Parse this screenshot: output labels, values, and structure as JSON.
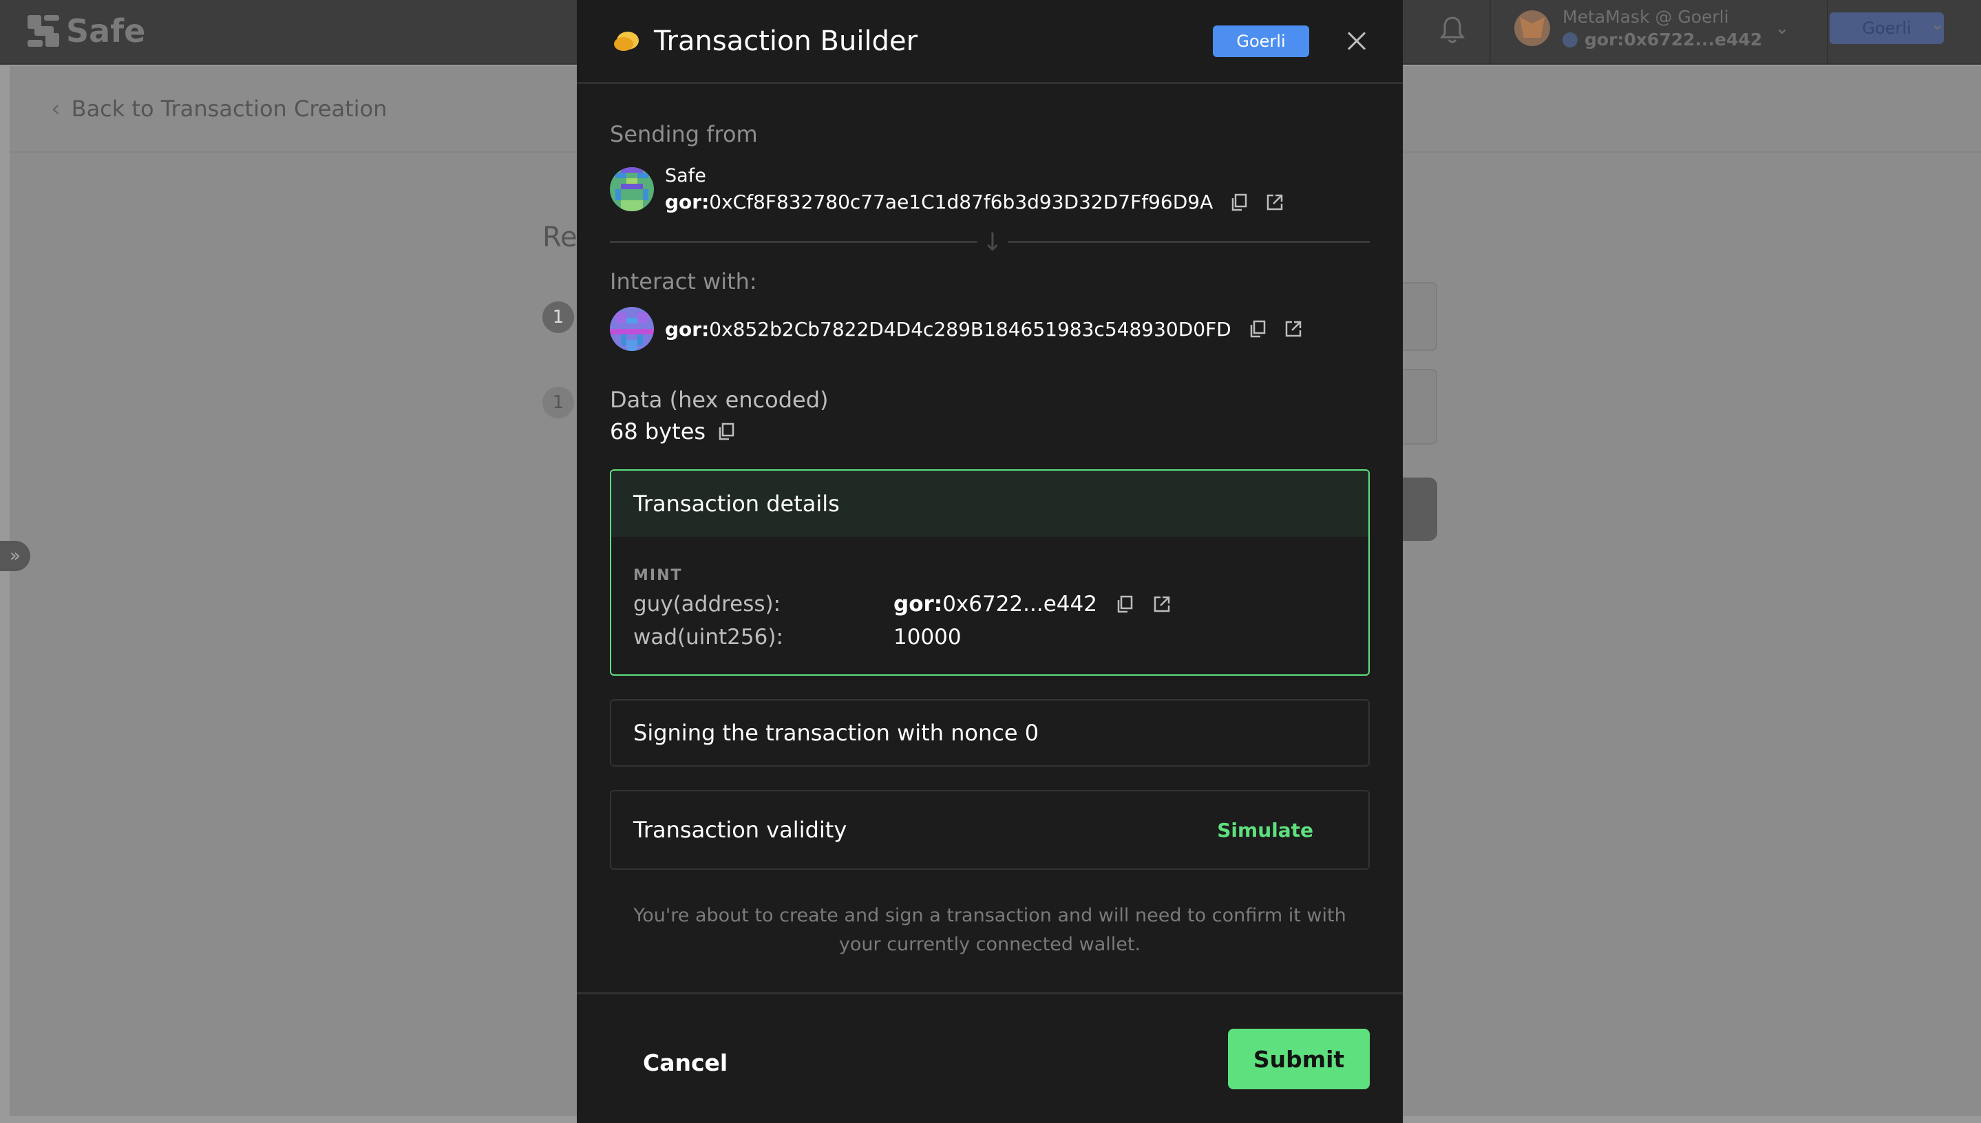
{
  "app": {
    "logo_text": "Safe",
    "wallet": {
      "title": "MetaMask @ Goerli",
      "address": "gor:0x6722...e442"
    },
    "network": "Goerli",
    "back_link": "Back to Transaction Creation",
    "page_title_partial": "Re",
    "step_numbers": [
      "1",
      "1"
    ]
  },
  "modal": {
    "title": "Transaction Builder",
    "network_chip": "Goerli",
    "sending_from_label": "Sending from",
    "from": {
      "name": "Safe",
      "prefix": "gor:",
      "address": "0xCf8F832780c77ae1C1d87f6b3d93D32D7Ff96D9A"
    },
    "interact_label": "Interact with:",
    "to": {
      "prefix": "gor:",
      "address": "0x852b2Cb7822D4D4c289B184651983c548930D0FD"
    },
    "data_label": "Data (hex encoded)",
    "data_size": "68 bytes",
    "details": {
      "header": "Transaction details",
      "method": "MINT",
      "params": [
        {
          "name": "guy(address):",
          "prefix": "gor:",
          "value": "0x6722...e442"
        },
        {
          "name": "wad(uint256):",
          "value": "10000"
        }
      ]
    },
    "nonce_text": "Signing the transaction with nonce 0",
    "validity_label": "Transaction validity",
    "simulate_label": "Simulate",
    "note": "You're about to create and sign a transaction and will need to confirm it with your currently connected wallet.",
    "cancel_label": "Cancel",
    "submit_label": "Submit"
  },
  "colors": {
    "accent_green": "#5ee07e",
    "network_blue": "#4c8ff0",
    "modal_bg": "#1c1c1c"
  },
  "icons": [
    "safe-logo-icon",
    "bell-icon",
    "metamask-icon",
    "chevron-down-icon",
    "chevron-left-icon",
    "coin-icon",
    "close-icon",
    "copy-icon",
    "external-link-icon",
    "arrow-down-icon",
    "double-chevron-right-icon"
  ]
}
